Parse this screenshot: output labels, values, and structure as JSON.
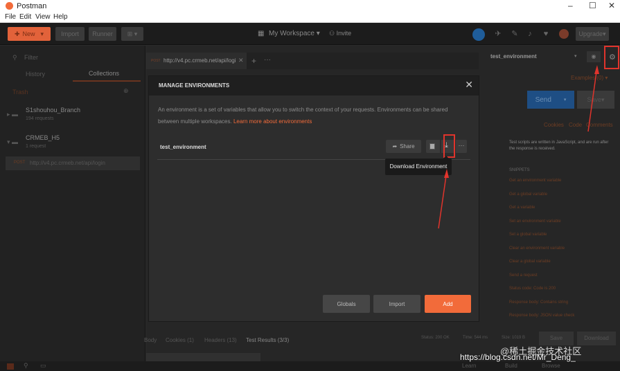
{
  "app": {
    "title": "Postman",
    "menu": [
      "File",
      "Edit",
      "View",
      "Help"
    ]
  },
  "toolbar": {
    "new_label": "New",
    "import_label": "Import",
    "runner_label": "Runner",
    "workspace_label": "My Workspace",
    "invite_label": "Invite",
    "upgrade_label": "Upgrade"
  },
  "sidebar": {
    "filter_placeholder": "Filter",
    "tabs": [
      "History",
      "Collections"
    ],
    "trash_label": "Trash",
    "collections": [
      {
        "name": "S1shouhou_Branch",
        "requests": "194 requests"
      },
      {
        "name": "CRMEB_H5",
        "requests": "1 request"
      }
    ],
    "request": {
      "method": "POST",
      "url": "http://v4.pc.crmeb.net/api/login"
    }
  },
  "request_tab": {
    "method": "POST",
    "url": "http://v4.pc.crmeb.net/api/logi"
  },
  "environment": {
    "selected": "test_environment",
    "examples_label": "Examples (0)"
  },
  "request_bar": {
    "send_label": "Send",
    "save_label": "Save",
    "links": [
      "Cookies",
      "Code",
      "Comments"
    ]
  },
  "right_panel": {
    "intro": "Test scripts are written in JavaScript, and are run after the response is received.",
    "snippets_label": "SNIPPETS",
    "snippets": [
      "Get an environment variable",
      "Get a global variable",
      "Get a variable",
      "Set an environment variable",
      "Set a global variable",
      "Clear an environment variable",
      "Clear a global variable",
      "Send a request",
      "Status code: Code is 200",
      "Response body: Contains string",
      "Response body: JSON value check"
    ]
  },
  "modal": {
    "title": "MANAGE ENVIRONMENTS",
    "description": "An environment is a set of variables that allow you to switch the context of your requests. Environments can be shared between multiple workspaces.",
    "link_text": "Learn more about environments",
    "env_name": "test_environment",
    "share_label": "Share",
    "tooltip": "Download Environment",
    "globals_label": "Globals",
    "import_label": "Import",
    "add_label": "Add"
  },
  "bottom": {
    "tabs": [
      "Body",
      "Cookies (1)",
      "Headers (13)",
      "Test Results (3/3)"
    ],
    "status": "Status: 200 OK",
    "time": "Time: 544 ms",
    "size": "Size: 1019 B",
    "save_label": "Save",
    "download_label": "Download"
  },
  "statusbar": {
    "learn_label": "Learn",
    "build_label": "Build",
    "browse_label": "Browse"
  },
  "watermark": {
    "line1": "@稀土掘金技术社区",
    "line2": "https://blog.csdn.net/Mr_Deng_"
  },
  "colors": {
    "accent": "#f26b3a",
    "highlight": "#e0342c",
    "send": "#1e4e84"
  }
}
